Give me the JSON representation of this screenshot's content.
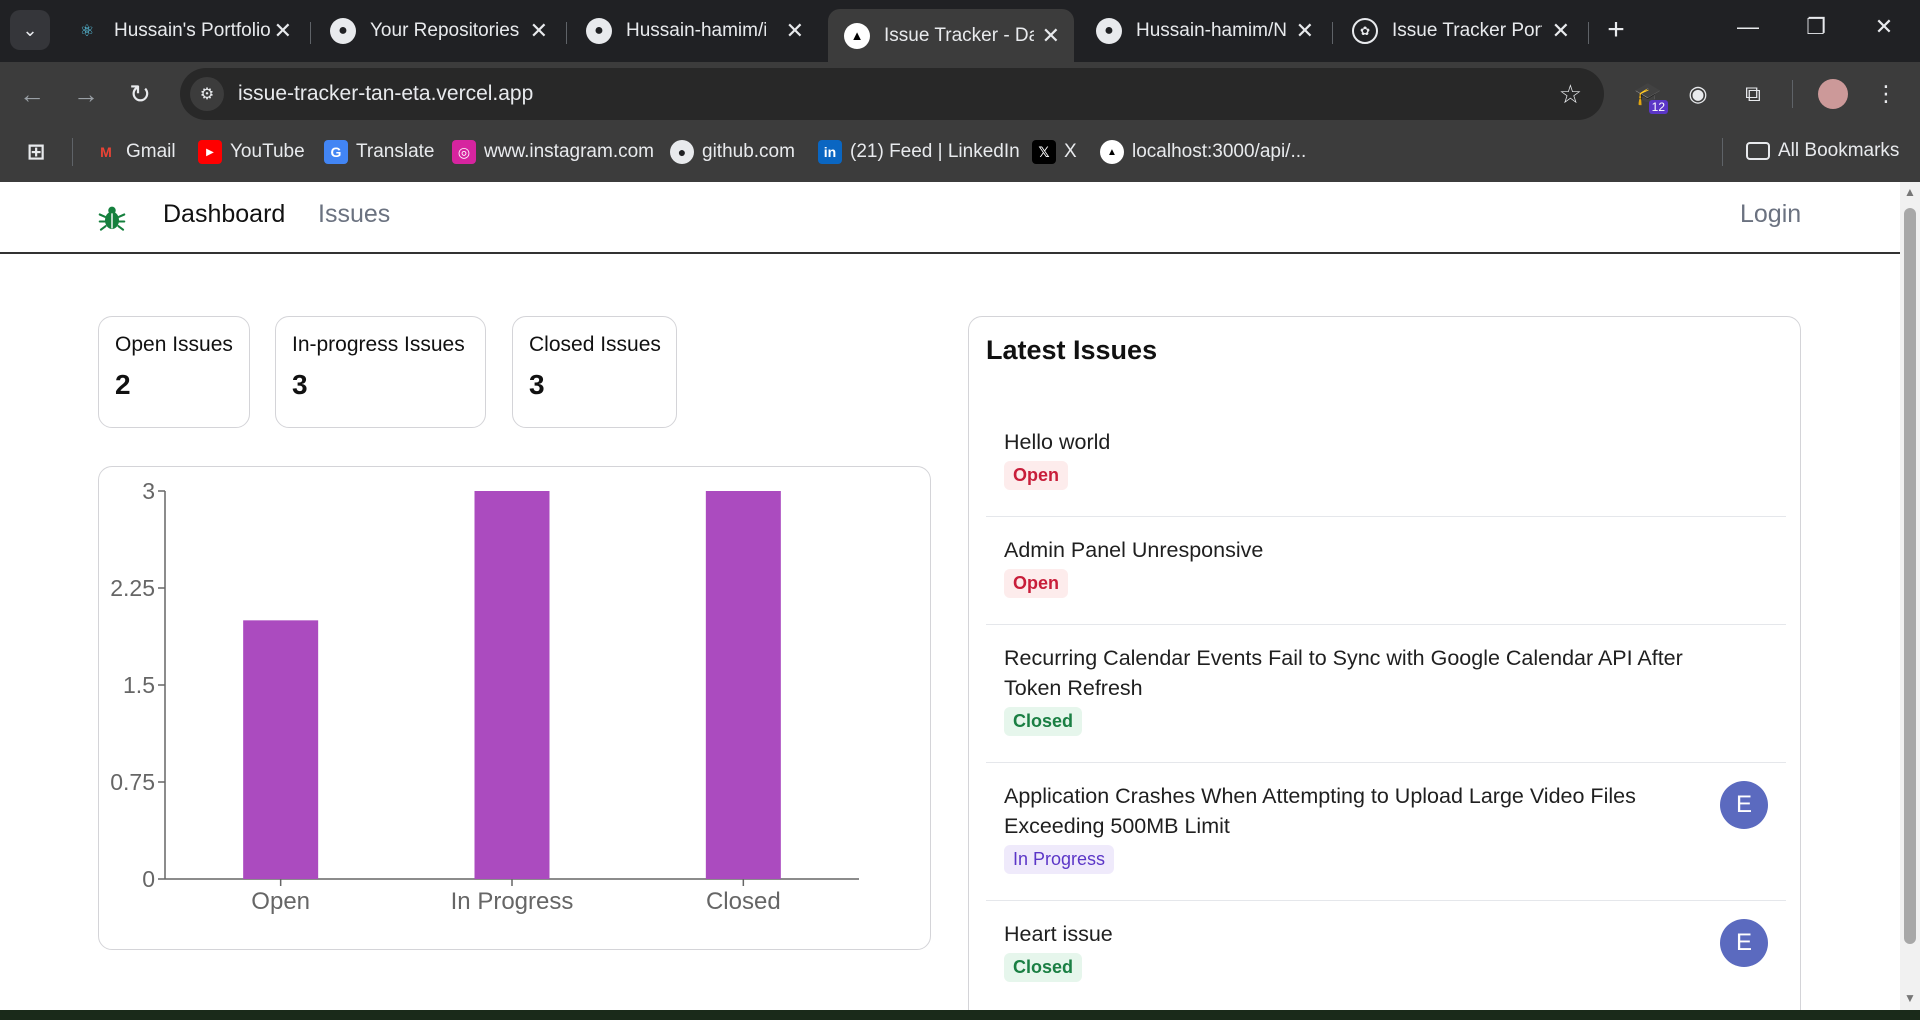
{
  "browser": {
    "tabs": [
      {
        "label": "Hussain's Portfolio",
        "icon": "react-icon"
      },
      {
        "label": "Your Repositories",
        "icon": "github-icon"
      },
      {
        "label": "Hussain-hamim/issue-tracker",
        "icon": "github-icon"
      },
      {
        "label": "Issue Tracker - Dashboard",
        "icon": "vercel-icon"
      },
      {
        "label": "Hussain-hamim/Next",
        "icon": "github-icon"
      },
      {
        "label": "Issue Tracker Portfolio",
        "icon": "chatgpt-icon"
      }
    ],
    "url": "issue-tracker-tan-eta.vercel.app",
    "extension_badge": "12",
    "bookmarks": [
      {
        "label": "Gmail"
      },
      {
        "label": "YouTube"
      },
      {
        "label": "Translate"
      },
      {
        "label": "www.instagram.com"
      },
      {
        "label": "github.com"
      },
      {
        "label": "(21) Feed | LinkedIn"
      },
      {
        "label": "X"
      },
      {
        "label": "localhost:3000/api/..."
      }
    ],
    "all_bookmarks": "All Bookmarks"
  },
  "nav": {
    "dashboard": "Dashboard",
    "issues": "Issues",
    "login": "Login"
  },
  "summary": [
    {
      "label": "Open Issues",
      "value": "2"
    },
    {
      "label": "In-progress Issues",
      "value": "3"
    },
    {
      "label": "Closed Issues",
      "value": "3"
    }
  ],
  "chart_data": {
    "type": "bar",
    "categories": [
      "Open",
      "In Progress",
      "Closed"
    ],
    "values": [
      2,
      3,
      3
    ],
    "ylim": [
      0,
      3
    ],
    "yticks": [
      "0",
      "0.75",
      "1.5",
      "2.25",
      "3"
    ],
    "color": "#ab4bbf"
  },
  "latest": {
    "title": "Latest Issues",
    "issues": [
      {
        "title": "Hello world",
        "status": "Open",
        "assignee": ""
      },
      {
        "title": "Admin Panel Unresponsive",
        "status": "Open",
        "assignee": ""
      },
      {
        "title": "Recurring Calendar Events Fail to Sync with Google Calendar API After Token Refresh",
        "status": "Closed",
        "assignee": ""
      },
      {
        "title": "Application Crashes When Attempting to Upload Large Video Files Exceeding 500MB Limit",
        "status": "In Progress",
        "assignee": "E"
      },
      {
        "title": "Heart issue",
        "status": "Closed",
        "assignee": "E"
      }
    ]
  },
  "colors": {
    "accent": "#ab4bbf",
    "open": "#c81e3a",
    "closed": "#1a7f43",
    "in_progress": "#5b36c7",
    "avatar": "#5b6abf",
    "logo": "#15803d"
  }
}
